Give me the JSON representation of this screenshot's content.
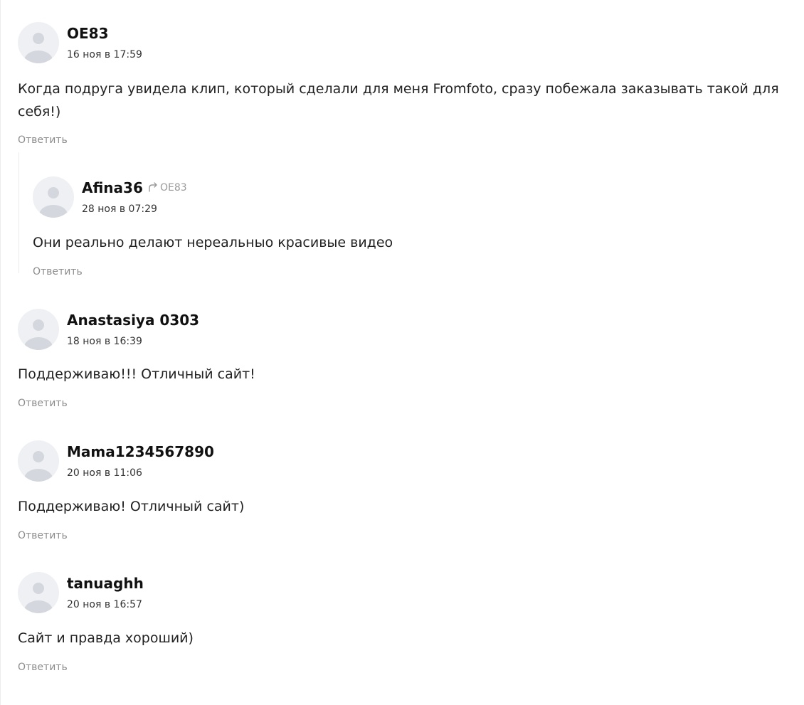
{
  "comments": [
    {
      "author": "OE83",
      "date": "16 ноя в 17:59",
      "text": "Когда подруга увидела клип, который сделали для меня Fromfoto, сразу побежала заказывать такой для себя!)",
      "reply_label": "Ответить"
    },
    {
      "author": "Afina36",
      "reply_to": "OE83",
      "date": "28 ноя в 07:29",
      "text": "Они реально делают нереальныо красивые видео",
      "reply_label": "Ответить"
    },
    {
      "author": "Anastasiya 0303",
      "date": "18 ноя в 16:39",
      "text": "Поддерживаю!!! Отличный сайт!",
      "reply_label": "Ответить"
    },
    {
      "author": "Mama1234567890",
      "date": "20 ноя в 11:06",
      "text": "Поддерживаю! Отличный сайт)",
      "reply_label": "Ответить"
    },
    {
      "author": "tanuaghh",
      "date": "20 ноя в 16:57",
      "text": "Сайт и правда хороший)",
      "reply_label": "Ответить"
    }
  ]
}
